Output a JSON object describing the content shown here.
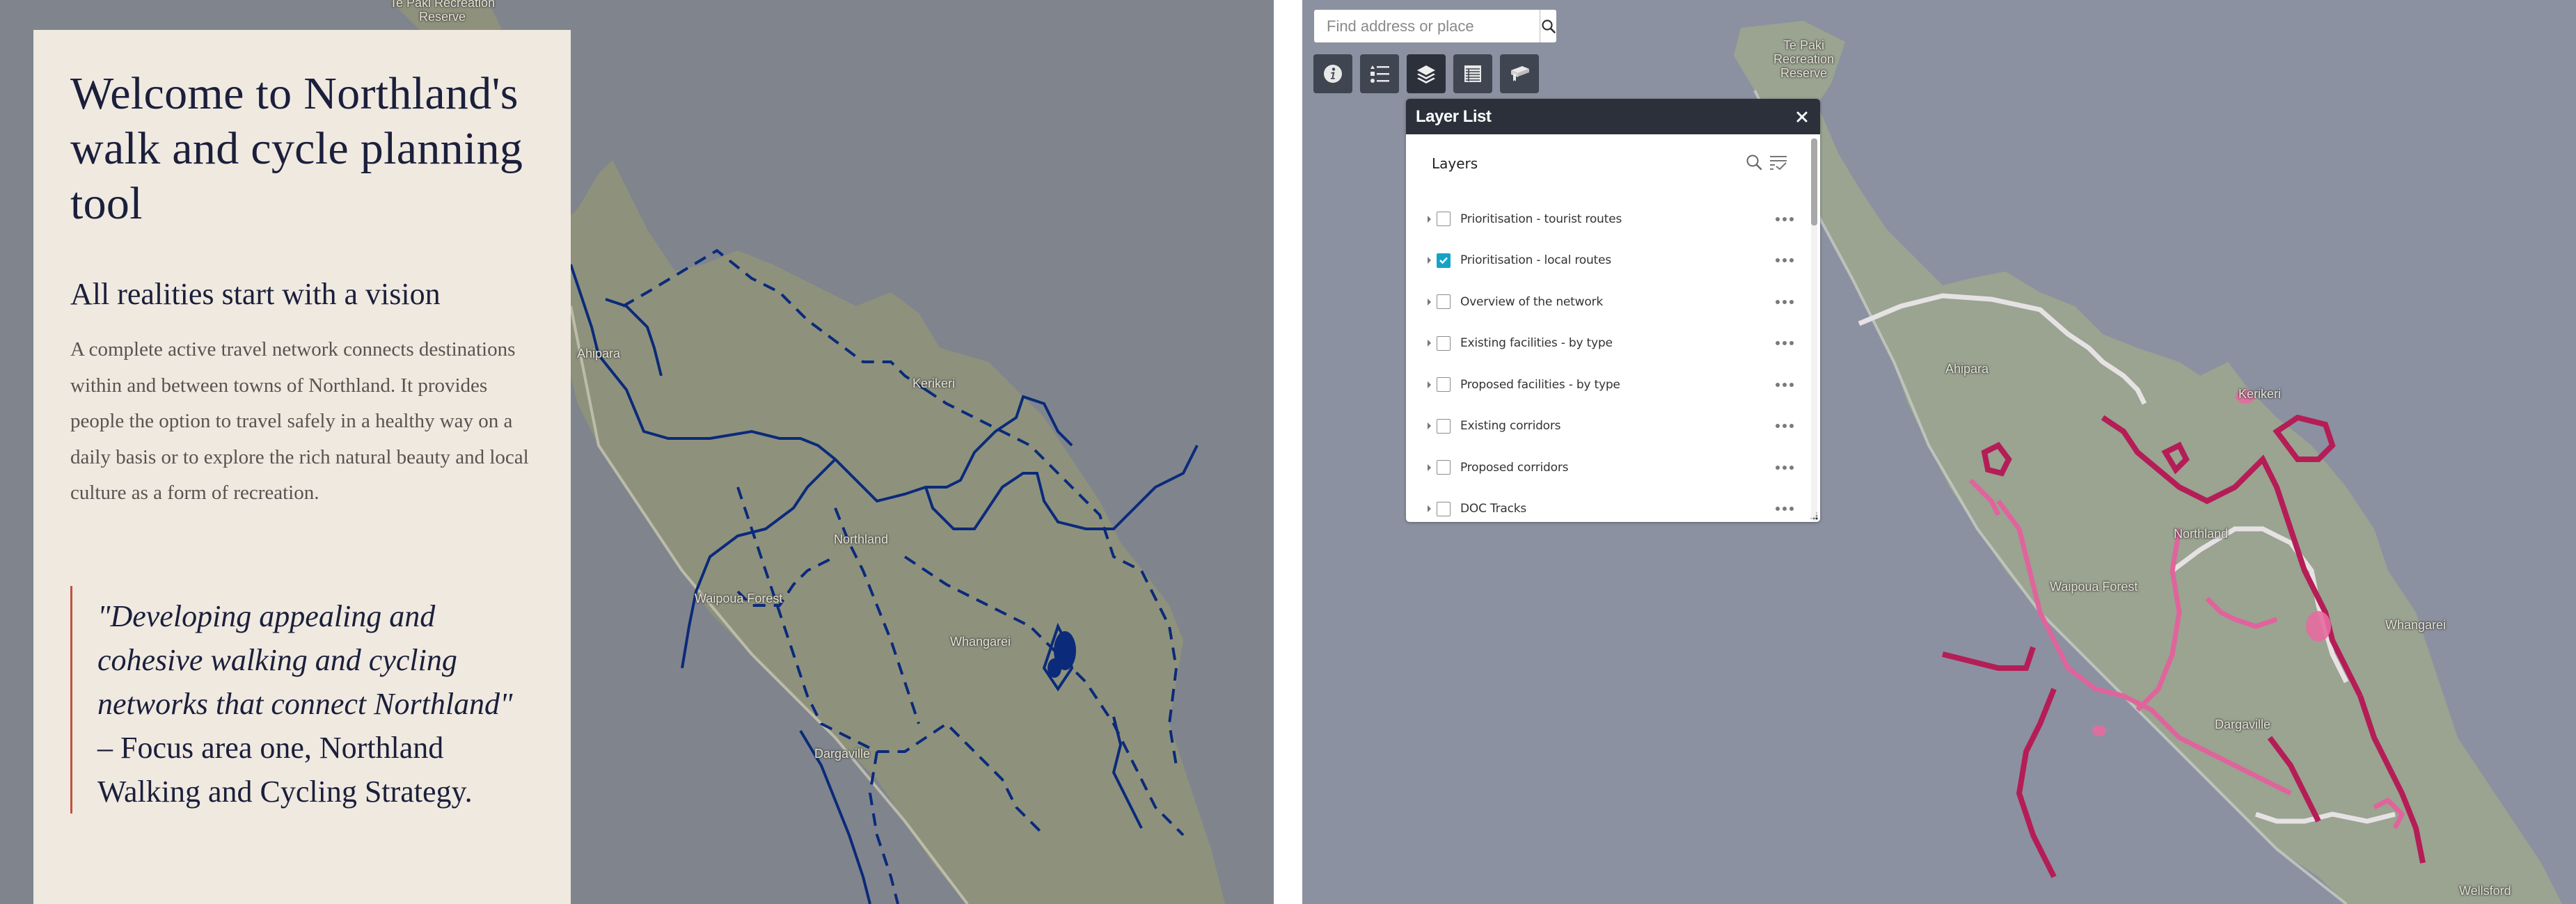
{
  "intro": {
    "title": "Welcome to Northland's walk and cycle planning tool",
    "subtitle": "All realities start with a vision",
    "body": "A complete active travel network connects destinations within and between towns of Northland. It provides people the option to travel safely in a healthy way on a daily basis or to explore the rich natural beauty and local culture as a form of recreation.",
    "quote_italic": "\"Developing appealing and cohesive walking and cycling networks that connect Northland\"",
    "quote_attribution": " – Focus area one, Northland Walking and Cycling Strategy.",
    "quote_accent_color": "#c0523f"
  },
  "left_map": {
    "route_color": "#0b2a7a",
    "labels": {
      "te_paki_line1": "Te Paki Recreation",
      "te_paki_line2": "Reserve",
      "ahipara": "Ahipara",
      "kerikeri": "Kerikeri",
      "northland": "Northland",
      "waipoua": "Waipoua Forest",
      "whangarei": "Whangarei",
      "dargaville": "Dargaville"
    }
  },
  "right_map": {
    "route_colors": [
      "#c2185b",
      "#e0609a",
      "#e9e3e6"
    ],
    "search": {
      "placeholder": "Find address or place",
      "value": ""
    },
    "toolbar": [
      {
        "name": "info",
        "icon": "info-icon",
        "active": false
      },
      {
        "name": "legend",
        "icon": "legend-icon",
        "active": false
      },
      {
        "name": "layer-list",
        "icon": "layers-icon",
        "active": true
      },
      {
        "name": "attribute-table",
        "icon": "table-icon",
        "active": false
      },
      {
        "name": "bookmark",
        "icon": "bookmark-icon",
        "active": false
      }
    ],
    "layer_panel": {
      "title": "Layer List",
      "subheading": "Layers",
      "layers": [
        {
          "label": "Prioritisation - tourist routes",
          "checked": false
        },
        {
          "label": "Prioritisation - local routes",
          "checked": true
        },
        {
          "label": "Overview of the network",
          "checked": false
        },
        {
          "label": "Existing facilities - by type",
          "checked": false
        },
        {
          "label": "Proposed facilities - by type",
          "checked": false
        },
        {
          "label": "Existing corridors",
          "checked": false
        },
        {
          "label": "Proposed corridors",
          "checked": false
        },
        {
          "label": "DOC Tracks",
          "checked": false
        }
      ],
      "checkbox_checked_color": "#14a3c7"
    },
    "labels": {
      "te_paki_line1": "Te Paki",
      "te_paki_line2": "Recreation",
      "te_paki_line3": "Reserve",
      "ahipara": "Ahipara",
      "kerikeri": "Kerikeri",
      "northland": "Northland",
      "waipoua": "Waipoua Forest",
      "whangarei": "Whangarei",
      "dargaville": "Dargaville",
      "wellsford": "Wellsford"
    }
  }
}
